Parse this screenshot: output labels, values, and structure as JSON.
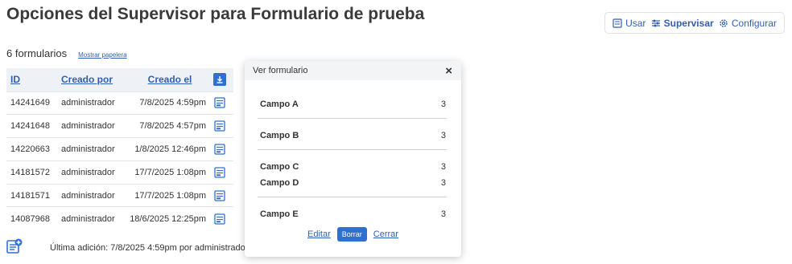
{
  "page": {
    "title": "Opciones del Supervisor para Formulario de prueba"
  },
  "modes": [
    {
      "label": "Usar",
      "icon": "form-icon",
      "active": false
    },
    {
      "label": "Supervisar",
      "icon": "sliders-icon",
      "active": true
    },
    {
      "label": "Configurar",
      "icon": "gear-icon",
      "active": false
    }
  ],
  "summary": {
    "count": "6 formularios",
    "trash_link": "Mostrar papelera"
  },
  "table": {
    "headers": {
      "id": "ID",
      "by": "Creado por",
      "at": "Creado el",
      "download_icon": "download-icon"
    },
    "rows": [
      {
        "id": "14241649",
        "by": "administrador",
        "at": "7/8/2025 4:59pm"
      },
      {
        "id": "14241648",
        "by": "administrador",
        "at": "7/8/2025 4:57pm"
      },
      {
        "id": "14220663",
        "by": "administrador",
        "at": "1/8/2025 12:46pm"
      },
      {
        "id": "14181572",
        "by": "administrador",
        "at": "17/7/2025 1:08pm"
      },
      {
        "id": "14181571",
        "by": "administrador",
        "at": "17/7/2025 1:08pm"
      },
      {
        "id": "14087968",
        "by": "administrador",
        "at": "18/6/2025 12:25pm"
      }
    ]
  },
  "footer": {
    "last_added": "Última adición: 7/8/2025 4:59pm por administrador",
    "add_icon": "add-form-icon"
  },
  "modal": {
    "title": "Ver formulario",
    "close": "×",
    "fields": [
      {
        "name": "Campo A",
        "value": "3"
      },
      {
        "name": "Campo B",
        "value": "3"
      },
      {
        "name": "Campo C",
        "value": "3"
      },
      {
        "name": "Campo D",
        "value": "3"
      },
      {
        "name": "Campo E",
        "value": "3"
      }
    ],
    "actions": {
      "edit": "Editar",
      "delete": "Borrar",
      "close": "Cerrar"
    }
  },
  "colors": {
    "accent": "#2f6fd0",
    "link": "#2f5fb3",
    "header_bg": "#eef1f5"
  }
}
